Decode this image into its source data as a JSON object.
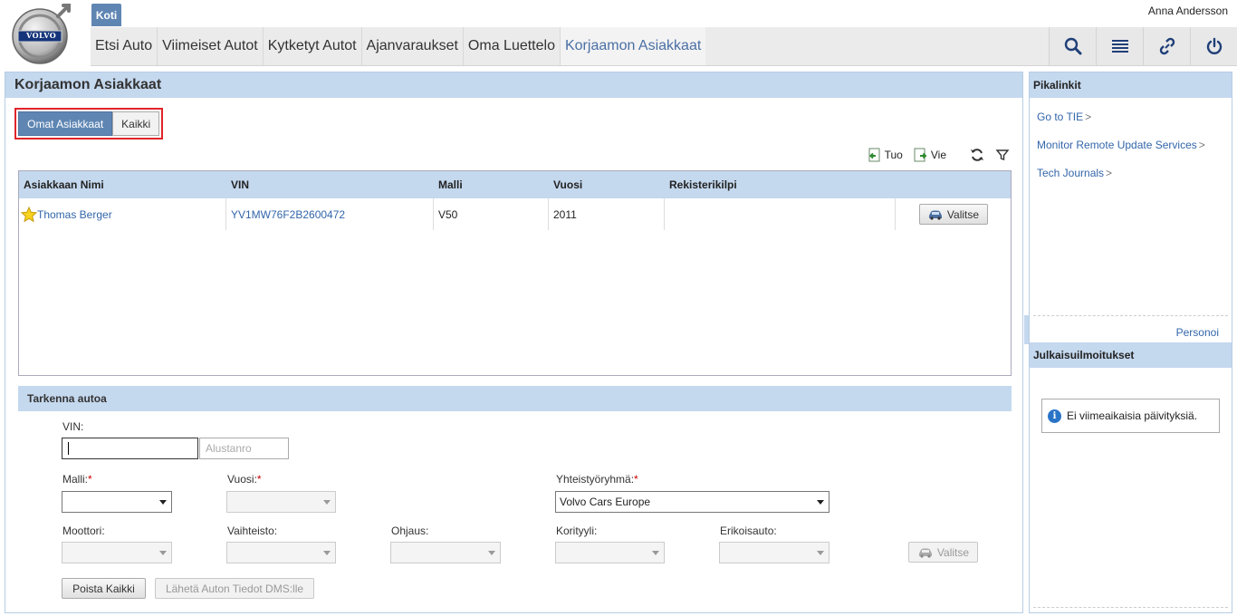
{
  "header": {
    "home_tab": "Koti",
    "user": "Anna Andersson",
    "brand": "VOLVO",
    "nav": [
      "Etsi Auto",
      "Viimeiset Autot",
      "Kytketyt Autot",
      "Ajanvaraukset",
      "Oma Luettelo",
      "Korjaamon Asiakkaat"
    ],
    "active_nav": "Korjaamon Asiakkaat",
    "icons": [
      "search-icon",
      "list-icon",
      "link-icon",
      "power-icon"
    ]
  },
  "main": {
    "title": "Korjaamon Asiakkaat",
    "segments": [
      "Omat Asiakkaat",
      "Kaikki"
    ],
    "toolbar": {
      "import": "Tuo",
      "export": "Vie"
    },
    "table": {
      "columns": [
        "Asiakkaan Nimi",
        "VIN",
        "Malli",
        "Vuosi",
        "Rekisterikilpi"
      ],
      "rows": [
        {
          "name": "Thomas Berger",
          "vin": "YV1MW76F2B2600472",
          "model": "V50",
          "year": "2011",
          "plate": "",
          "action": "Valitse"
        }
      ]
    }
  },
  "refine": {
    "title": "Tarkenna autoa",
    "vin_label": "VIN:",
    "vin_value": "",
    "chassis_placeholder": "Alustanro",
    "model_label": "Malli:",
    "year_label": "Vuosi:",
    "group_label": "Yhteistyöryhmä:",
    "group_value": "Volvo Cars Europe",
    "engine_label": "Moottori:",
    "gearbox_label": "Vaihteisto:",
    "steering_label": "Ohjaus:",
    "body_label": "Korityyli:",
    "special_label": "Erikoisauto:",
    "required_mark": "*",
    "select_button": "Valitse",
    "clear_button": "Poista Kaikki",
    "send_button": "Lähetä Auton Tiedot DMS:lle"
  },
  "side": {
    "title": "Pikalinkit",
    "links": [
      "Go to TIE",
      "Monitor Remote Update Services",
      "Tech Journals"
    ],
    "chevron": ">",
    "personalize": "Personoi",
    "notices_title": "Julkaisuilmoitukset",
    "notice_text": "Ei viimeaikaisia päivityksiä."
  }
}
